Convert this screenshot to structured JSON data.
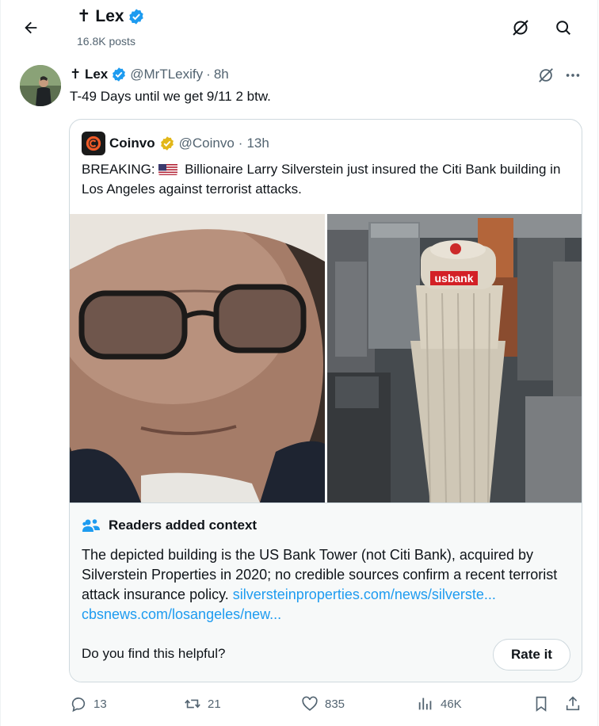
{
  "header": {
    "name": "✝ Lex",
    "posts_count": "16.8K posts"
  },
  "post": {
    "name": "✝ Lex",
    "handle": "@MrTLexify",
    "separator": "·",
    "time": "8h",
    "text": "T-49 Days until we get 9/11 2 btw."
  },
  "quote": {
    "name": "Coinvo",
    "handle": "@Coinvo",
    "separator": "·",
    "time": "13h",
    "text_prefix": "BREAKING:",
    "text_body": "Billionaire Larry Silverstein just insured the Citi Bank building in Los Angeles against terrorist attacks.",
    "building_sign": "usbank"
  },
  "context": {
    "title": "Readers added context",
    "body": "The depicted building is the US Bank Tower (not Citi Bank), acquired by Silverstein Properties in 2020; no credible sources confirm a recent terrorist attack insurance policy.",
    "link1": "silversteinproperties.com/news/silverste...",
    "link2": "cbsnews.com/losangeles/new...",
    "helpful_question": "Do you find this helpful?",
    "rate_label": "Rate it"
  },
  "actions": {
    "replies": "13",
    "reposts": "21",
    "likes": "835",
    "views": "46K"
  },
  "colors": {
    "accent": "#1d9bf0",
    "verified_blue": "#1d9bf0",
    "verified_gold": "#e2b719",
    "text_primary": "#0f1419",
    "text_secondary": "#536471",
    "border": "#cfd9de"
  }
}
